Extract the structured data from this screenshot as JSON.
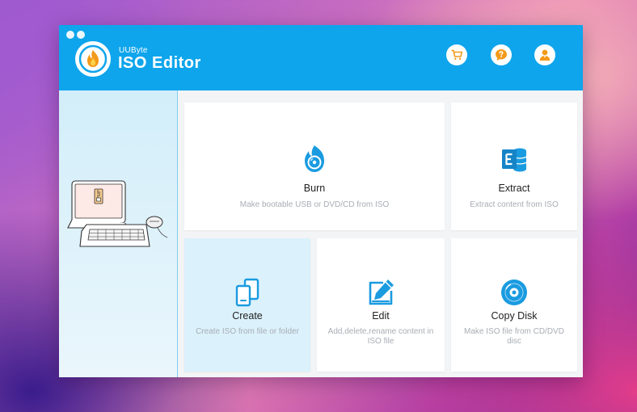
{
  "app": {
    "brand_small": "UUByte",
    "brand_title": "ISO Editor"
  },
  "header": {
    "buttons": [
      {
        "icon": "cart-icon",
        "tooltip": ""
      },
      {
        "icon": "help-icon",
        "tooltip": ""
      },
      {
        "icon": "user-icon",
        "tooltip": ""
      }
    ]
  },
  "colors": {
    "header_bg": "#0ea5ec",
    "accent_orange": "#f39a1a",
    "icon_blue": "#1a9be0",
    "active_card_bg": "#dbf1fc"
  },
  "cards": [
    {
      "id": "burn",
      "title": "Burn",
      "desc": "Make bootable USB or DVD/CD from ISO",
      "icon": "burn-disc-icon",
      "active": false
    },
    {
      "id": "extract",
      "title": "Extract",
      "desc": "Extract content from ISO",
      "icon": "extract-database-icon",
      "active": false
    },
    {
      "id": "create",
      "title": "Create",
      "desc": "Create ISO from file or folder",
      "icon": "create-files-icon",
      "active": true
    },
    {
      "id": "edit",
      "title": "Edit",
      "desc": "Add,delete,rename content in ISO file",
      "icon": "edit-pencil-icon",
      "active": false
    },
    {
      "id": "copy",
      "title": "Copy Disk",
      "desc": "Make ISO file from CD/DVD disc",
      "icon": "copy-disk-icon",
      "active": false
    }
  ]
}
